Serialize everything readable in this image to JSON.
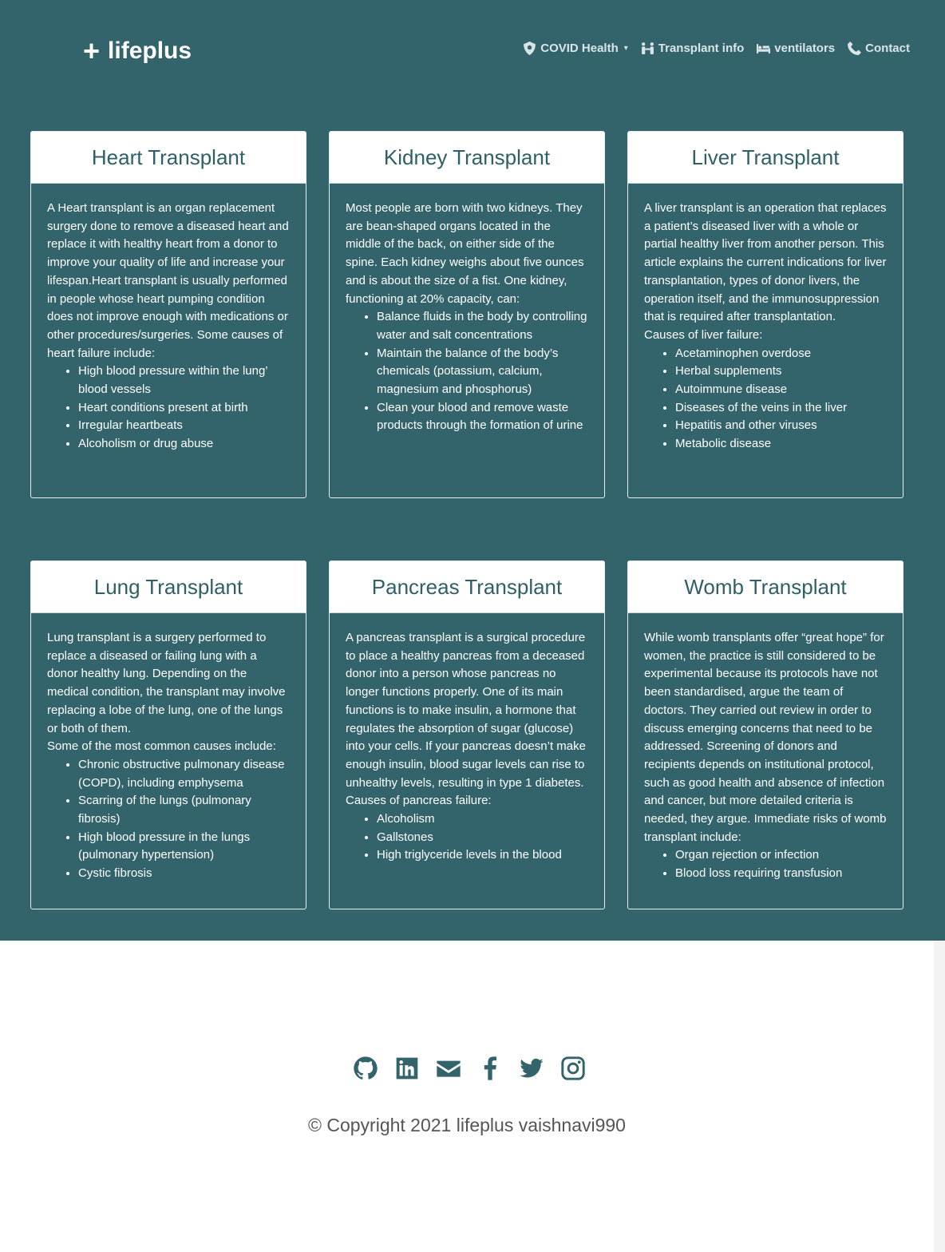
{
  "brand": {
    "plus": "+",
    "name": "lifeplus"
  },
  "nav": [
    {
      "label": "COVID Health",
      "icon": "shield-virus-icon",
      "dropdown": true
    },
    {
      "label": "Transplant info",
      "icon": "people-arrows-icon"
    },
    {
      "label": "ventilators",
      "icon": "bed-icon"
    },
    {
      "label": "Contact",
      "icon": "phone-icon"
    }
  ],
  "cards": [
    {
      "title": "Heart Transplant",
      "intro": "A Heart transplant is an organ replacement surgery done to remove a diseased heart and replace it with healthy heart from a donor to improve your quality of life and increase your lifespan.Heart transplant is usually performed in people whose heart pumping condition does not improve enough with medications or other procedures/surgeries. Some causes of heart failure include:",
      "items": [
        "High blood pressure within the lung’ blood vessels",
        "Heart conditions present at birth",
        "Irregular heartbeats",
        "Alcoholism or drug abuse"
      ]
    },
    {
      "title": "Kidney Transplant",
      "intro": "Most people are born with two kidneys. They are bean-shaped organs located in the middle of the back, on either side of the spine. Each kidney weighs about five ounces and is about the size of a fist. One kidney, functioning at 20% capacity, can:",
      "items": [
        "Balance fluids in the body by controlling water and salt concentrations",
        "Maintain the balance of the body’s chemicals (potassium, calcium, magnesium and phosphorus)",
        "Clean your blood and remove waste products through the formation of urine"
      ]
    },
    {
      "title": "Liver Transplant",
      "intro": "A liver transplant is an operation that replaces a patient’s diseased liver with a whole or partial healthy liver from another person. This article explains the current indications for liver transplantation, types of donor livers, the operation itself, and the immunosuppression that is required after transplantation.",
      "intro2": "Causes of liver failure:",
      "items": [
        "Acetaminophen overdose",
        "Herbal supplements",
        "Autoimmune disease",
        "Diseases of the veins in the liver",
        "Hepatitis and other viruses",
        "Metabolic disease"
      ]
    },
    {
      "title": "Lung Transplant",
      "intro": "Lung transplant is a surgery performed to replace a diseased or failing lung with a donor healthy lung. Depending on the medical condition, the transplant may involve replacing a lobe of the lung, one of the lungs or both of them.",
      "intro2": "Some of the most common causes include:",
      "items": [
        "Chronic obstructive pulmonary disease (COPD), including emphysema",
        "Scarring of the lungs (pulmonary fibrosis)",
        "High blood pressure in the lungs (pulmonary hypertension)",
        "Cystic fibrosis"
      ]
    },
    {
      "title": "Pancreas Transplant",
      "intro": "A pancreas transplant is a surgical procedure to place a healthy pancreas from a deceased donor into a person whose pancreas no longer functions properly. One of its main functions is to make insulin, a hormone that regulates the absorption of sugar (glucose) into your cells. If your pancreas doesn’t make enough insulin, blood sugar levels can rise to unhealthy levels, resulting in type 1 diabetes. Causes of pancreas failure:",
      "items": [
        "Alcoholism",
        "Gallstones",
        "High triglyceride levels in the blood"
      ]
    },
    {
      "title": "Womb Transplant",
      "intro": "While womb transplants offer “great hope” for women, the practice is still considered to be experimental because its protocols have not been standardised, argue the team of doctors. They carried out review in order to discuss emerging concerns that need to be addressed. Screening of donors and recipients depends on institutional protocol, such as good health and absence of infection and cancer, but more detailed criteria is needed, they argue. Immediate risks of womb transplant include:",
      "items": [
        "Organ rejection or infection",
        "Blood loss requiring transfusion"
      ]
    }
  ],
  "social": [
    "github-icon",
    "linkedin-icon",
    "envelope-icon",
    "facebook-icon",
    "twitter-icon",
    "instagram-icon"
  ],
  "copyright": "© Copyright 2021 lifeplus vaishnavi990",
  "colors": {
    "primary": "#33646c",
    "white": "#ffffff"
  }
}
